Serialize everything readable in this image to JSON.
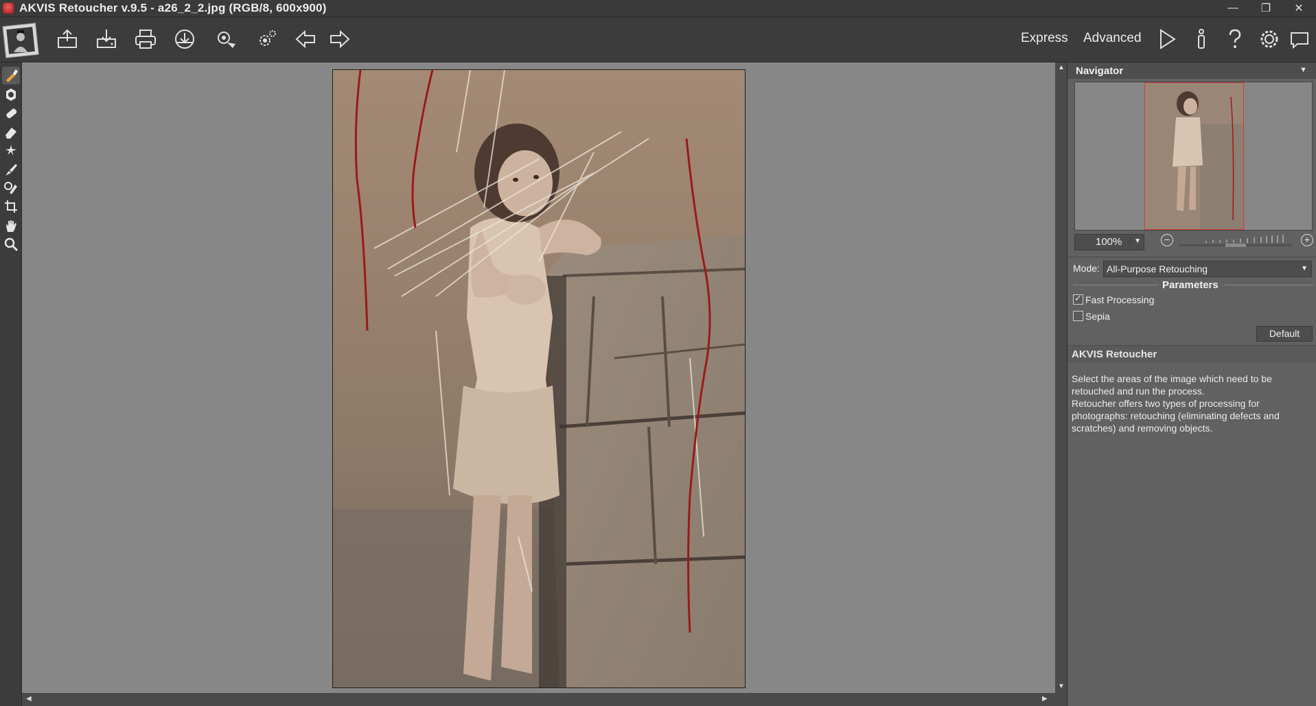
{
  "window": {
    "title": "AKVIS Retoucher v.9.5 - a26_2_2.jpg (RGB/8, 600x900)",
    "controls": {
      "minimize": "—",
      "restore": "❐",
      "close": "✕"
    }
  },
  "toolbar": {
    "buttons": [
      "open-icon",
      "save-icon",
      "print-icon",
      "share-icon",
      "batch-icon",
      "settings-icon",
      "undo-arrow-icon",
      "redo-arrow-icon"
    ],
    "modes": {
      "express": "Express",
      "advanced": "Advanced"
    },
    "right_buttons": [
      "run-icon",
      "info-icon",
      "help-icon",
      "preferences-icon",
      "chat-icon"
    ]
  },
  "tools": [
    "retouch-brush-icon",
    "object-remover-icon",
    "patch-icon",
    "eraser-icon",
    "magic-wand-icon",
    "clone-brush-icon",
    "chameleon-brush-icon",
    "crop-icon",
    "hand-icon",
    "zoom-icon"
  ],
  "navigator": {
    "title": "Navigator",
    "zoom_value": "100%"
  },
  "settings": {
    "mode_label": "Mode:",
    "mode_value": "All-Purpose Retouching",
    "parameters_title": "Parameters",
    "fast_processing_label": "Fast Processing",
    "fast_processing_checked": true,
    "sepia_label": "Sepia",
    "sepia_checked": false,
    "default_button": "Default"
  },
  "help": {
    "title": "AKVIS Retoucher",
    "text": "Select the areas of the image which need to be retouched and run the process.\nRetoucher offers two types of processing for photographs: retouching (eliminating defects and scratches) and removing objects."
  },
  "colors": {
    "background": "#3c3c3c",
    "canvas": "#878787",
    "panel": "#616161",
    "selection_stroke": "#a01818"
  }
}
